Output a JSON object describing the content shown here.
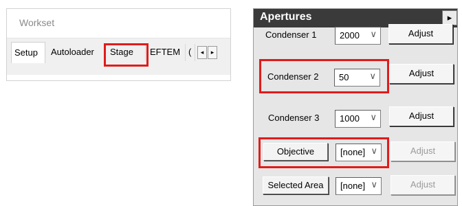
{
  "workset": {
    "title": "Workset",
    "tabs": [
      "Setup",
      "Autoloader",
      "Stage",
      "EFTEM",
      "("
    ],
    "scroll_left": "◂",
    "scroll_right": "▸"
  },
  "apertures": {
    "title": "Apertures",
    "expand_glyph": "▸",
    "chevron": "∨",
    "rows": [
      {
        "label": "Condenser 1",
        "value": "2000",
        "adjust": "Adjust",
        "enabled": true
      },
      {
        "label": "Condenser 2",
        "value": "50",
        "adjust": "Adjust",
        "enabled": true
      },
      {
        "label": "Condenser 3",
        "value": "1000",
        "adjust": "Adjust",
        "enabled": true
      },
      {
        "label": "Objective",
        "value": "[none]",
        "adjust": "Adjust",
        "enabled": false
      },
      {
        "label": "Selected Area",
        "value": "[none]",
        "adjust": "Adjust",
        "enabled": false
      }
    ]
  },
  "colors": {
    "highlight": "#e01b1b",
    "header_bg": "#3a3a3a",
    "panel_bg": "#e6e6e6"
  }
}
